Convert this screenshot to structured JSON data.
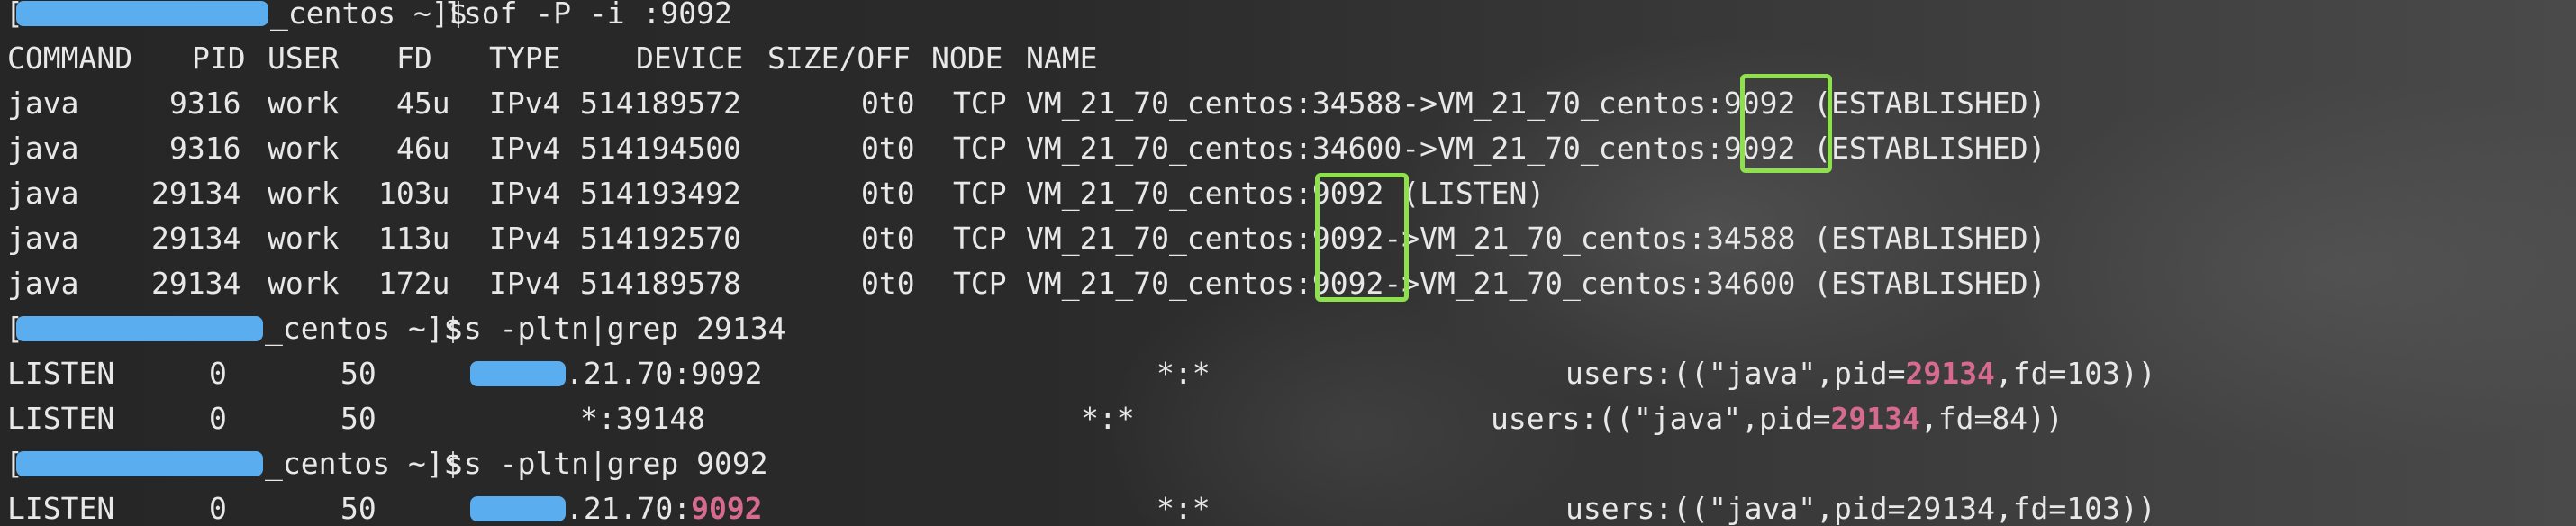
{
  "terminal": {
    "lines": [
      {
        "prompt_suffix": "_centos ~]$",
        "command": "lsof -P -i :9092"
      },
      {
        "header": {
          "command": "COMMAND",
          "pid": "PID",
          "user": "USER",
          "fd": "FD",
          "type": "TYPE",
          "device": "DEVICE",
          "size_off": "SIZE/OFF",
          "node": "NODE",
          "name": "NAME"
        }
      }
    ],
    "lsof_rows": [
      {
        "command": "java",
        "pid": "9316",
        "user": "work",
        "fd": "45u",
        "type": "IPv4",
        "device": "514189572",
        "size_off": "0t0",
        "node": "TCP",
        "name_pre": "VM_21_70_centos:34588->VM_21_70_centos:",
        "name_port": "9092",
        "name_post": " (ESTABLISHED)"
      },
      {
        "command": "java",
        "pid": "9316",
        "user": "work",
        "fd": "46u",
        "type": "IPv4",
        "device": "514194500",
        "size_off": "0t0",
        "node": "TCP",
        "name_pre": "VM_21_70_centos:34600->VM_21_70_centos:",
        "name_port": "9092",
        "name_post": " (ESTABLISHED)"
      },
      {
        "command": "java",
        "pid": "29134",
        "user": "work",
        "fd": "103u",
        "type": "IPv4",
        "device": "514193492",
        "size_off": "0t0",
        "node": "TCP",
        "name_pre": "VM_21_70_centos:",
        "name_port": "9092",
        "name_post": " (LISTEN)"
      },
      {
        "command": "java",
        "pid": "29134",
        "user": "work",
        "fd": "113u",
        "type": "IPv4",
        "device": "514192570",
        "size_off": "0t0",
        "node": "TCP",
        "name_pre": "VM_21_70_centos:",
        "name_port": "9092",
        "name_post": "->VM_21_70_centos:34588 (ESTABLISHED)"
      },
      {
        "command": "java",
        "pid": "29134",
        "user": "work",
        "fd": "172u",
        "type": "IPv4",
        "device": "514189578",
        "size_off": "0t0",
        "node": "TCP",
        "name_pre": "VM_21_70_centos:",
        "name_port": "9092",
        "name_post": "->VM_21_70_centos:34600 (ESTABLISHED)"
      }
    ],
    "ss1": {
      "prompt_suffix": "_centos ~]$",
      "command": "ss -pltn|grep 29134",
      "rows": [
        {
          "state": "LISTEN",
          "recvq": "0",
          "sendq": "50",
          "local_suffix": ".21.70:9092",
          "peer": "*:*",
          "proc_pre": "users:((\"java\",pid=",
          "proc_pid": "29134",
          "proc_post": ",fd=103))"
        },
        {
          "state": "LISTEN",
          "recvq": "0",
          "sendq": "50",
          "local": "*:39148",
          "peer": "*:*",
          "proc_pre": "users:((\"java\",pid=",
          "proc_pid": "29134",
          "proc_post": ",fd=84))"
        }
      ]
    },
    "ss2": {
      "prompt_suffix": "_centos ~]$",
      "command": "ss -pltn|grep 9092",
      "rows": [
        {
          "state": "LISTEN",
          "recvq": "0",
          "sendq": "50",
          "local_mid": ".21.70:",
          "local_port": "9092",
          "peer": "*:*",
          "proc": "users:((\"java\",pid=29134,fd=103))"
        }
      ]
    },
    "prompt_open": "[",
    "colors": {
      "text": "#e8e8e8",
      "highlight_pink": "#d66a8f",
      "annotation_box": "#8ee04f",
      "redaction_mask": "#5aaef0"
    }
  }
}
